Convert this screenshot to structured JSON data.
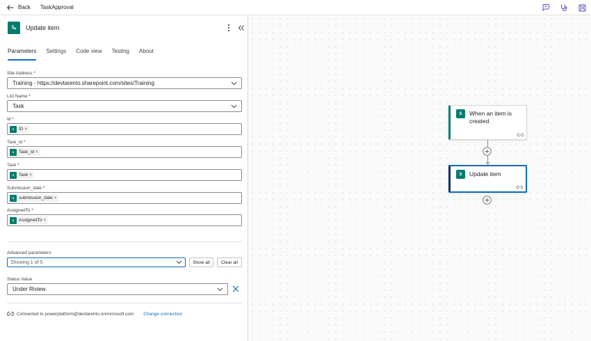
{
  "topbar": {
    "back_label": "Back",
    "flow_name": "TaskApproval"
  },
  "panel": {
    "title": "Update item",
    "tabs": [
      {
        "label": "Parameters"
      },
      {
        "label": "Settings"
      },
      {
        "label": "Code view"
      },
      {
        "label": "Testing"
      },
      {
        "label": "About"
      }
    ],
    "site_address": {
      "label": "Site Address *",
      "value": "Training - https://devtarento.sharepoint.com/sites/Training"
    },
    "list_name": {
      "label": "List Name *",
      "value": "Task"
    },
    "id": {
      "label": "Id *",
      "token": "ID"
    },
    "task_id": {
      "label": "Task_id *",
      "token": "Task_id"
    },
    "task": {
      "label": "Task *",
      "token": "Task"
    },
    "submission_date": {
      "label": "Submission_date *",
      "token": "submission_date"
    },
    "assigned_to": {
      "label": "AssignedTo *",
      "token": "AssignedTo"
    },
    "advanced": {
      "label": "Advanced parameters",
      "value": "Showing 1 of 5",
      "show_all": "Show all",
      "clear_all": "Clear all"
    },
    "status": {
      "label": "Status Value",
      "value": "Under Riview"
    },
    "connection": {
      "text": "Connected to powerplatform@devtarento.onmicrosoft.com.",
      "change_label": "Change connection"
    },
    "token_remove": "×"
  },
  "canvas": {
    "trigger_title_line1": "When an item is",
    "trigger_title_line2": "created",
    "action_title": "Update item"
  },
  "colors": {
    "sharepoint": "#037c6e",
    "accent": "#0f6cbd"
  },
  "icons": [
    "back-arrow-icon",
    "feedback-icon",
    "flow-checker-icon",
    "save-icon",
    "sharepoint-icon",
    "more-options-icon",
    "collapse-icon",
    "chevron-down-icon",
    "close-icon",
    "connection-icon",
    "add-icon"
  ]
}
